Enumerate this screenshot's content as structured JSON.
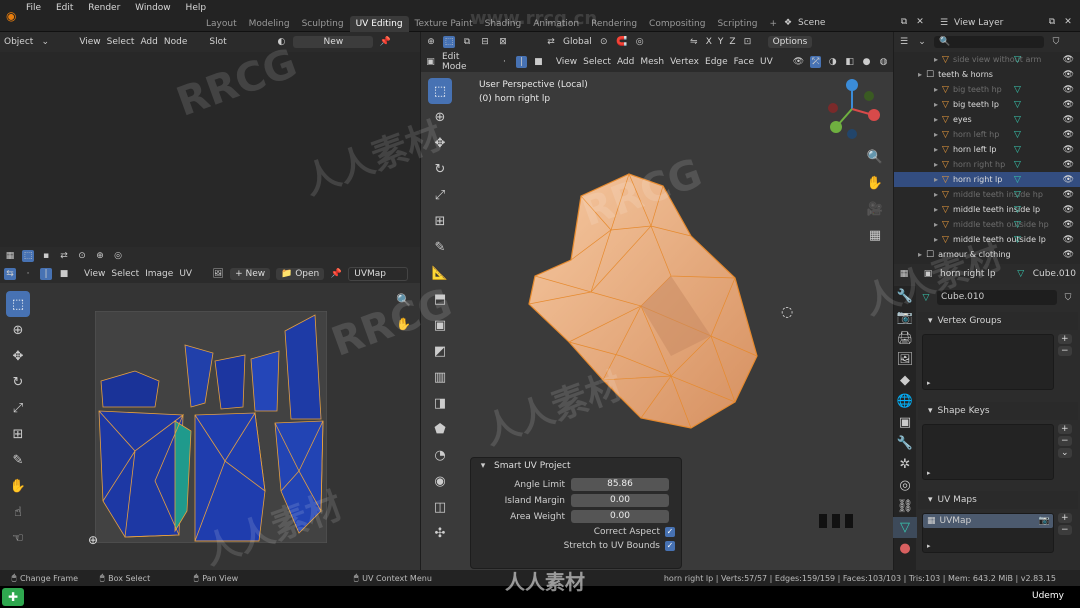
{
  "topbar": {
    "menu": [
      "File",
      "Edit",
      "Render",
      "Window",
      "Help"
    ],
    "workspaces": [
      "Layout",
      "Modeling",
      "Sculpting",
      "UV Editing",
      "Texture Paint",
      "Shading",
      "Animation",
      "Rendering",
      "Compositing",
      "Scripting",
      "+"
    ],
    "scene_label": "Scene",
    "view_layer_label": "View Layer"
  },
  "shader_editor": {
    "header": {
      "mode": "Object",
      "view": "View",
      "select": "Select",
      "add": "Add",
      "node": "Node",
      "slot": "Slot",
      "new_label": "New"
    }
  },
  "uv_editor": {
    "header": {
      "view": "View",
      "select": "Select",
      "image": "Image",
      "uv": "UV",
      "new_label": "New",
      "open_label": "Open",
      "uvmap_name": "UVMap"
    }
  },
  "viewport": {
    "header": {
      "transform": "Global",
      "options": "Options",
      "axes": [
        "X",
        "Y",
        "Z"
      ]
    },
    "header2": {
      "mode": "Edit Mode",
      "view": "View",
      "select": "Select",
      "add": "Add",
      "mesh": "Mesh",
      "vertex": "Vertex",
      "edge": "Edge",
      "face": "Face",
      "uv": "UV"
    },
    "perspective_label": "User Perspective (Local)",
    "object_label": "(0) horn right lp"
  },
  "smart_uv_panel": {
    "title": "Smart UV Project",
    "angle_limit_label": "Angle Limit",
    "angle_limit_value": "85.86",
    "island_margin_label": "Island Margin",
    "island_margin_value": "0.00",
    "area_weight_label": "Area Weight",
    "area_weight_value": "0.00",
    "correct_aspect_label": "Correct Aspect",
    "stretch_label": "Stretch to UV Bounds",
    "correct_aspect_checked": true,
    "stretch_checked": true
  },
  "outliner": {
    "rows": [
      {
        "label": "side view without arm",
        "dim": true
      },
      {
        "label": "teeth & horns",
        "dim": false,
        "collection": true
      },
      {
        "label": "big teeth hp",
        "dim": true
      },
      {
        "label": "big teeth lp",
        "dim": false
      },
      {
        "label": "eyes",
        "dim": false
      },
      {
        "label": "horn left hp",
        "dim": true
      },
      {
        "label": "horn left lp",
        "dim": false
      },
      {
        "label": "horn right hp",
        "dim": true
      },
      {
        "label": "horn right lp",
        "dim": false,
        "selected": true
      },
      {
        "label": "middle teeth inside hp",
        "dim": true
      },
      {
        "label": "middle teeth inside lp",
        "dim": false
      },
      {
        "label": "middle teeth outside hp",
        "dim": true
      },
      {
        "label": "middle teeth outside lp",
        "dim": false
      },
      {
        "label": "armour & clothing",
        "dim": false,
        "collection": true
      }
    ]
  },
  "properties": {
    "object_name": "horn right lp",
    "mesh_name": "Cube.010",
    "mesh_field": "Cube.010",
    "vertex_groups_label": "Vertex Groups",
    "shape_keys_label": "Shape Keys",
    "uv_maps_label": "UV Maps",
    "uvmap_item": "UVMap"
  },
  "statusbar": {
    "change_frame": "Change Frame",
    "box_select": "Box Select",
    "pan_view": "Pan View",
    "uv_context_menu": "UV Context Menu",
    "stats": "horn right lp | Verts:57/57 | Edges:159/159 | Faces:103/103 | Tris:103 | Mem: 643.2 MiB | v2.83.15"
  },
  "watermarks": {
    "site": "www.rrcg.cn",
    "brand": "RRCG",
    "cn": "人人素材",
    "udemy": "Udemy"
  },
  "colors": {
    "accent": "#4772b3",
    "mesh": "#f0b080",
    "mesh_edge": "#e68a2e",
    "uv_island": "#1f3aa8",
    "selected_row": "#334d80"
  }
}
